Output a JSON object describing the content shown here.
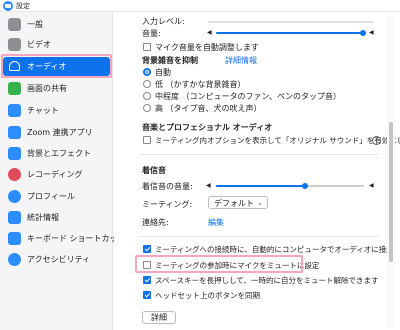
{
  "window": {
    "title": "設定"
  },
  "sidebar": {
    "items": [
      {
        "label": "一般",
        "icon": "gear-icon",
        "color": "#8e8e93"
      },
      {
        "label": "ビデオ",
        "icon": "video-icon",
        "color": "#8e8e93"
      },
      {
        "label": "オーディオ",
        "icon": "headphones-icon",
        "color": "#0e72ed"
      },
      {
        "label": "画面の共有",
        "icon": "share-screen-icon",
        "color": "#36b24a"
      },
      {
        "label": "チャット",
        "icon": "chat-icon",
        "color": "#2d8cff"
      },
      {
        "label": "Zoom 連携アプリ",
        "icon": "apps-icon",
        "color": "#2d8cff"
      },
      {
        "label": "背景とエフェクト",
        "icon": "background-icon",
        "color": "#2d8cff"
      },
      {
        "label": "レコーディング",
        "icon": "recording-icon",
        "color": "#e04a5c"
      },
      {
        "label": "プロフィール",
        "icon": "profile-icon",
        "color": "#2d8cff"
      },
      {
        "label": "統計情報",
        "icon": "statistics-icon",
        "color": "#2d8cff"
      },
      {
        "label": "キーボード ショートカット",
        "icon": "keyboard-icon",
        "color": "#2d8cff"
      },
      {
        "label": "アクセシビリティ",
        "icon": "accessibility-icon",
        "color": "#2d8cff"
      }
    ],
    "active_index": 2
  },
  "audio": {
    "input_level_label": "入力レベル:",
    "volume_label": "音量:",
    "auto_adjust_label": "マイク音量を自動調整します",
    "noise_section_label": "背景雑音を抑制",
    "noise_detail_link": "詳細情報",
    "noise_options": [
      {
        "label": "自動",
        "checked": true
      },
      {
        "label": "低 （かすかな背景雑音）",
        "checked": false
      },
      {
        "label": "中程度 （コンピュータのファン、ペンのタップ音）",
        "checked": false
      },
      {
        "label": "高 （タイプ音、犬の吠え声）",
        "checked": false
      }
    ],
    "music_section_label": "音楽とプロフェショナル オーディオ",
    "original_sound_label": "ミーティング内オプションを表示して「オリジナル サウンド」を有効にします",
    "ringtone_section_label": "着信音",
    "ringtone_volume_label": "着信音の音量:",
    "ringtone_volume_level": 0.6,
    "meeting_label": "ミーティング:",
    "meeting_value": "デフォルト",
    "contacts_label": "連絡先:",
    "contacts_edit_link": "編集",
    "join_auto_label": "ミーティングへの接続時に、自動的にコンピュータでオーディオに接続",
    "mute_on_join_label": "ミーティングの参加時にマイクをミュートに設定",
    "space_unmute_label": "スペースキーを長押しして、一時的に自分をミュート解除できます",
    "headset_sync_label": "ヘッドセット上のボタンを同期",
    "advanced_button": "詳細",
    "checkboxes": {
      "auto_adjust": false,
      "original_sound": false,
      "join_auto": true,
      "mute_on_join": false,
      "space_unmute": true,
      "headset_sync": true
    }
  },
  "colors": {
    "accent": "#0e72ed",
    "highlight": "#f4a6c0"
  }
}
